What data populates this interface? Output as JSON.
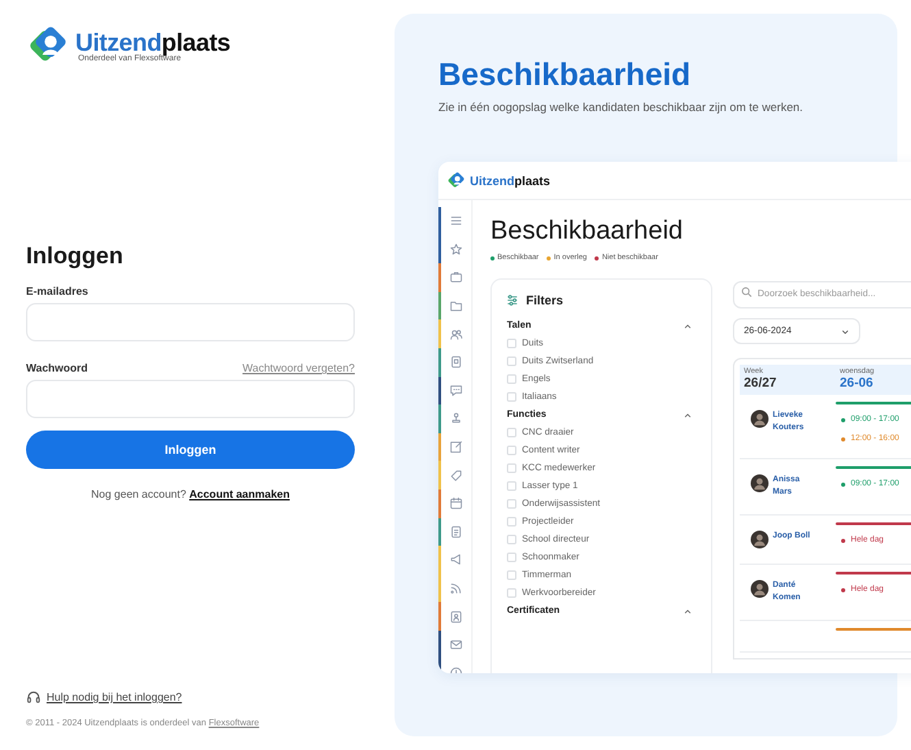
{
  "brand": {
    "name_parts": [
      "Uitzend",
      "plaats"
    ],
    "tagline": "Onderdeel van Flexsoftware"
  },
  "login": {
    "title": "Inloggen",
    "fields": [
      {
        "label": "E-mailadres"
      },
      {
        "label": "Wachwoord",
        "link": "Wachtwoord vergeten?"
      }
    ],
    "submit": "Inloggen",
    "signup": {
      "text": "Nog geen account?",
      "link": "Account aanmaken"
    }
  },
  "help_link": "Hulp nodig bij het inloggen?",
  "footer": {
    "text": "© 2011 - 2024 Uitzendplaats is onderdeel van",
    "link": "Flexsoftware"
  },
  "promo": {
    "title": "Beschikbaarheid",
    "subtitle": "Zie in één oogopslag welke kandidaten beschikbaar zijn om te werken."
  },
  "app": {
    "brand_parts": [
      "Uitzend",
      "plaats"
    ],
    "sidebar": [
      {
        "kind": "menu",
        "color": "#2f5f9e"
      },
      {
        "kind": "star",
        "color": "#2f5f9e"
      },
      {
        "kind": "briefcase",
        "color": "#e07b39"
      },
      {
        "kind": "folder",
        "color": "#5aa66a"
      },
      {
        "kind": "users",
        "color": "#f0c24b"
      },
      {
        "kind": "building",
        "color": "#3e9a8a"
      },
      {
        "kind": "chat",
        "color": "#2f4f80"
      },
      {
        "kind": "stamp",
        "color": "#3e9a8a"
      },
      {
        "kind": "edit",
        "color": "#e8a33c"
      },
      {
        "kind": "tag",
        "color": "#f0c24b"
      },
      {
        "kind": "calendar",
        "color": "#e07b39"
      },
      {
        "kind": "document",
        "color": "#3e9a8a"
      },
      {
        "kind": "megaphone",
        "color": "#f0c24b"
      },
      {
        "kind": "rss",
        "color": "#f0c24b"
      },
      {
        "kind": "contact",
        "color": "#e07b39"
      },
      {
        "kind": "mail",
        "color": "#2f4f80"
      },
      {
        "kind": "clock",
        "color": "#2f4f80"
      }
    ],
    "title": "Beschikbaarheid",
    "legend": [
      {
        "label": "Beschikbaar",
        "color": "#1e9e6a"
      },
      {
        "label": "In overleg",
        "color": "#e8a531"
      },
      {
        "label": "Niet beschikbaar",
        "color": "#c0394b"
      }
    ],
    "filters": {
      "title": "Filters",
      "groups": [
        {
          "title": "Talen",
          "expanded": true,
          "options": [
            {
              "label": "Duits",
              "checked": false
            },
            {
              "label": "Duits Zwitserland",
              "checked": false
            },
            {
              "label": "Engels",
              "checked": false
            },
            {
              "label": "Italiaans",
              "checked": false
            }
          ]
        },
        {
          "title": "Functies",
          "expanded": true,
          "options": [
            {
              "label": "CNC draaier",
              "checked": false
            },
            {
              "label": "Content writer",
              "checked": false
            },
            {
              "label": "KCC medewerker",
              "checked": false
            },
            {
              "label": "Lasser type 1",
              "checked": false
            },
            {
              "label": "Onderwijsassistent",
              "checked": false
            },
            {
              "label": "Projectleider",
              "checked": false
            },
            {
              "label": "School directeur",
              "checked": false
            },
            {
              "label": "Schoonmaker",
              "checked": false
            },
            {
              "label": "Timmerman",
              "checked": false
            },
            {
              "label": "Werkvoorbereider",
              "checked": false
            }
          ]
        },
        {
          "title": "Certificaten",
          "expanded": true
        }
      ]
    },
    "search": {
      "placeholder": "Doorzoek beschikbaarheid..."
    },
    "date": {
      "value": "26-06-2024"
    },
    "schedule": {
      "columns": [
        {
          "label": "Week",
          "value": "26/27"
        },
        {
          "label": "woensdag",
          "value": "26-06"
        }
      ],
      "rows": [
        {
          "name": "Lieveke Kouters",
          "color": "#1e9e6a",
          "entries": [
            {
              "text": "09:00 - 17:00",
              "color": "#1e9e6a"
            },
            {
              "text": "12:00 - 16:00",
              "color": "#e08a2c"
            }
          ]
        },
        {
          "name": "Anissa Mars",
          "color": "#1e9e6a",
          "entries": [
            {
              "text": "09:00 - 17:00",
              "color": "#1e9e6a"
            }
          ]
        },
        {
          "name": "Joop Boll",
          "color": "#c0394b",
          "entries": [
            {
              "text": "Hele dag",
              "color": "#c0394b"
            }
          ]
        },
        {
          "name": "Danté Komen",
          "color": "#c0394b",
          "entries": [
            {
              "text": "Hele dag",
              "color": "#c0394b"
            }
          ]
        },
        {
          "color": "#e08a2c"
        }
      ]
    }
  }
}
